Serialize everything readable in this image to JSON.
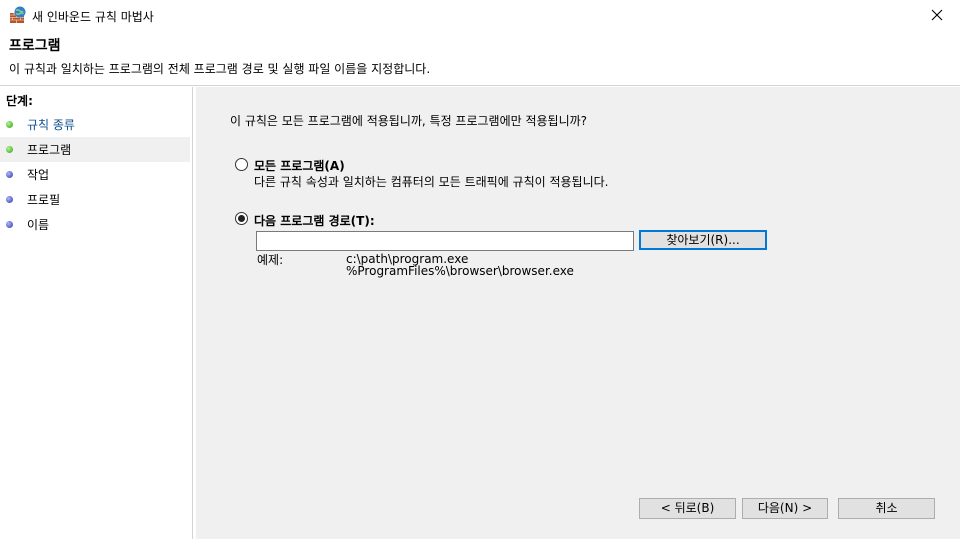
{
  "window": {
    "title": "새 인바운드 규칙 마법사",
    "close_icon": "close-icon"
  },
  "header": {
    "title": "프로그램",
    "description": "이 규칙과 일치하는 프로그램의 전체 프로그램 경로 및 실행 파일 이름을 지정합니다."
  },
  "sidebar": {
    "steps_label": "단계:",
    "items": [
      {
        "label": "규칙 종류",
        "state": "done",
        "link": true
      },
      {
        "label": "프로그램",
        "state": "done",
        "active": true
      },
      {
        "label": "작업",
        "state": "pending"
      },
      {
        "label": "프로필",
        "state": "pending"
      },
      {
        "label": "이름",
        "state": "pending"
      }
    ]
  },
  "main": {
    "question": "이 규칙은 모든 프로그램에 적용됩니까, 특정 프로그램에만 적용됩니까?",
    "option_all": {
      "label": "모든 프로그램(A)",
      "description": "다른 규칙 속성과 일치하는 컴퓨터의 모든 트래픽에 규칙이 적용됩니다.",
      "checked": false
    },
    "option_path": {
      "label": "다음 프로그램 경로(T):",
      "checked": true,
      "value": "",
      "browse_label": "찾아보기(R)..."
    },
    "example": {
      "label": "예제:",
      "values": [
        "c:\\path\\program.exe",
        "%ProgramFiles%\\browser\\browser.exe"
      ]
    }
  },
  "footer": {
    "back_label": "< 뒤로(B)",
    "next_label": "다음(N) >",
    "cancel_label": "취소"
  }
}
